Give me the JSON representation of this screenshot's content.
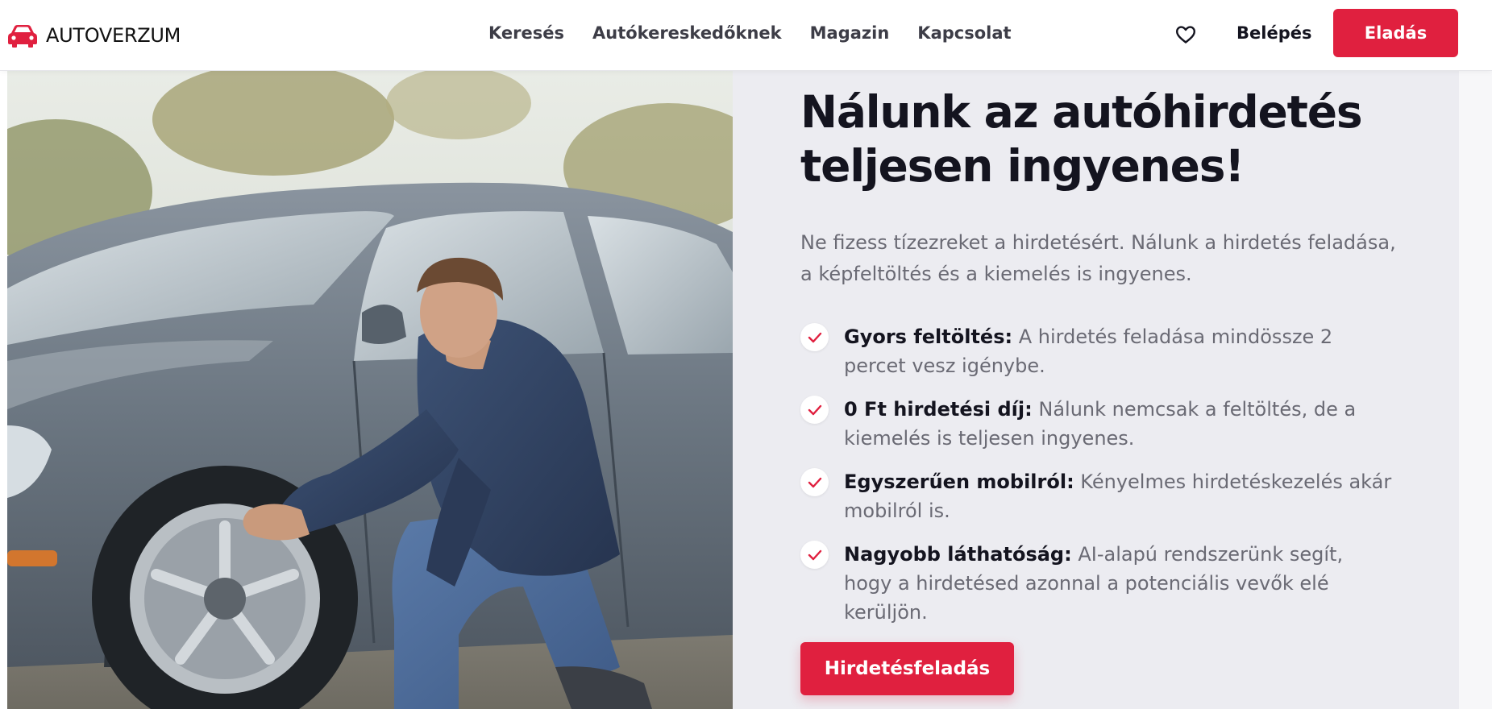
{
  "brand": {
    "name": "AUTOVERZUM",
    "accent_color": "#e0203f"
  },
  "nav": {
    "items": [
      {
        "label": "Keresés"
      },
      {
        "label": "Autókereskedőknek"
      },
      {
        "label": "Magazin"
      },
      {
        "label": "Kapcsolat"
      }
    ]
  },
  "header_actions": {
    "favorites_icon": "heart-icon",
    "login_label": "Belépés",
    "sell_label": "Eladás"
  },
  "hero": {
    "image_icon": "car-photo",
    "title": "Nálunk az autóhirdetés teljesen ingyenes!",
    "lead": "Ne fizess tízezreket a hirdetésért. Nálunk a hirdetés feladása, a képfeltöltés és a kiemelés is ingyenes.",
    "features": [
      {
        "title": "Gyors feltöltés:",
        "text": " A hirdetés feladása mindössze 2 percet vesz igénybe."
      },
      {
        "title": "0 Ft hirdetési díj:",
        "text": " Nálunk nemcsak a feltöltés, de a kiemelés is teljesen ingyenes."
      },
      {
        "title": "Egyszerűen mobilról:",
        "text": " Kényelmes hirdetéskezelés akár mobilról is."
      },
      {
        "title": "Nagyobb láthatóság:",
        "text": " AI-alapú rendszerünk segít, hogy a hirdetésed azonnal a potenciális vevők elé kerüljön."
      }
    ],
    "check_icon": "check-icon",
    "cta_label": "Hirdetésfeladás"
  }
}
